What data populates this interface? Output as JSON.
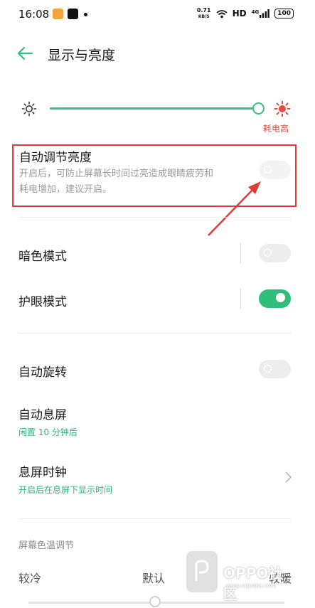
{
  "status_bar": {
    "time": "16:08",
    "speed_value": "0.71",
    "speed_unit": "KB/S",
    "hd": "HD",
    "network": "4G",
    "battery": "100"
  },
  "header": {
    "title": "显示与亮度"
  },
  "brightness": {
    "level": 1.0,
    "high_label": "耗电高"
  },
  "auto_brightness": {
    "title": "自动调节亮度",
    "desc_line1": "开启后，可防止屏幕长时间过亮造成眼睛疲劳和",
    "desc_line2": "耗电增加，建议开启。",
    "enabled": false
  },
  "dark_mode": {
    "title": "暗色模式",
    "enabled": false
  },
  "eye_care": {
    "title": "护眼模式",
    "enabled": true
  },
  "auto_rotate": {
    "title": "自动旋转",
    "enabled": false
  },
  "screen_timeout": {
    "title": "自动息屏",
    "subtitle": "闲置 10 分钟后"
  },
  "aod_clock": {
    "title": "息屏时钟",
    "subtitle": "开启后在息屏下显示时间"
  },
  "color_temp": {
    "section": "屏幕色温调节",
    "cool": "较冷",
    "default": "默认",
    "warm": "较暖"
  },
  "watermark": {
    "brand": "OPPO社区",
    "url": "www.oppojia.com"
  },
  "colors": {
    "accent": "#2fbf7a",
    "warning": "#e84a3c",
    "highlight": "#e03b3b"
  }
}
